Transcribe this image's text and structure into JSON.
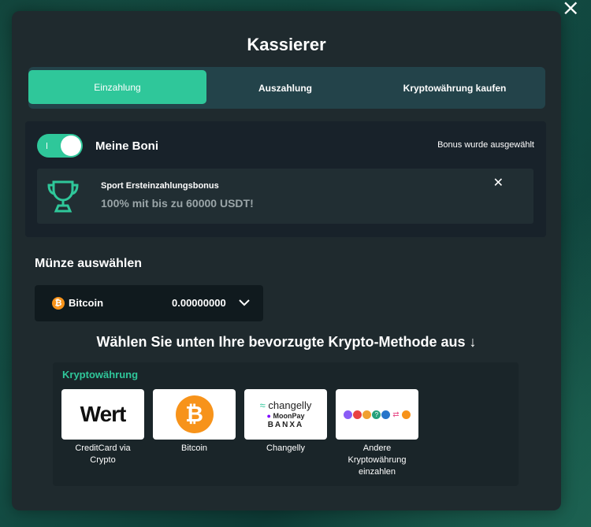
{
  "close_label": "×",
  "title": "Kassierer",
  "tabs": [
    {
      "label": "Einzahlung",
      "active": true
    },
    {
      "label": "Auszahlung",
      "active": false
    },
    {
      "label": "Kryptowährung kaufen",
      "active": false
    }
  ],
  "bonus": {
    "toggle_on": true,
    "label": "Meine Boni",
    "selected_text": "Bonus wurde ausgewählt",
    "card": {
      "name": "Sport Ersteinzahlungsbonus",
      "description": "100% mit bis zu 60000 USDT!",
      "close_label": "✕"
    }
  },
  "coin": {
    "heading": "Münze auswählen",
    "selected_symbol": "₿",
    "selected_name": "Bitcoin",
    "amount": "0.00000000"
  },
  "method_heading": "Wählen Sie unten Ihre bevorzugte Krypto-Methode aus ↓",
  "crypto": {
    "section_label": "Kryptowährung",
    "methods": [
      {
        "logo_text": "Wert",
        "label": "CreditCard via Crypto",
        "icon": "wert-logo"
      },
      {
        "logo_text": "₿",
        "label": "Bitcoin",
        "icon": "bitcoin-logo"
      },
      {
        "logo_text": "changelly",
        "logo_text2": "MoonPay",
        "logo_text3": "BANXA",
        "label": "Changelly",
        "icon": "changelly-logo"
      },
      {
        "logo_text": "?",
        "label": "Andere Kryptowährung einzahlen",
        "icon": "multi-coin-logo"
      }
    ]
  },
  "colors": {
    "accent": "#2fc79a",
    "modal_bg": "#1f2a2e",
    "bitcoin": "#f7931a"
  }
}
